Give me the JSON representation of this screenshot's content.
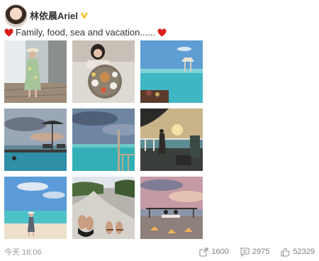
{
  "user": {
    "name": "林依晨Ariel"
  },
  "post": {
    "text": "Family, food, sea and vacation......"
  },
  "photos": [
    "photo-1",
    "photo-2",
    "photo-3",
    "photo-4",
    "photo-5",
    "photo-6",
    "photo-7",
    "photo-8",
    "photo-9"
  ],
  "footer": {
    "timestamp": "今天 16:06",
    "repost_count": "1600",
    "comment_count": "2975",
    "like_count": "52329"
  },
  "colors": {
    "heart": "#d9201c",
    "vip": "#f5b400",
    "meta": "#999999"
  }
}
